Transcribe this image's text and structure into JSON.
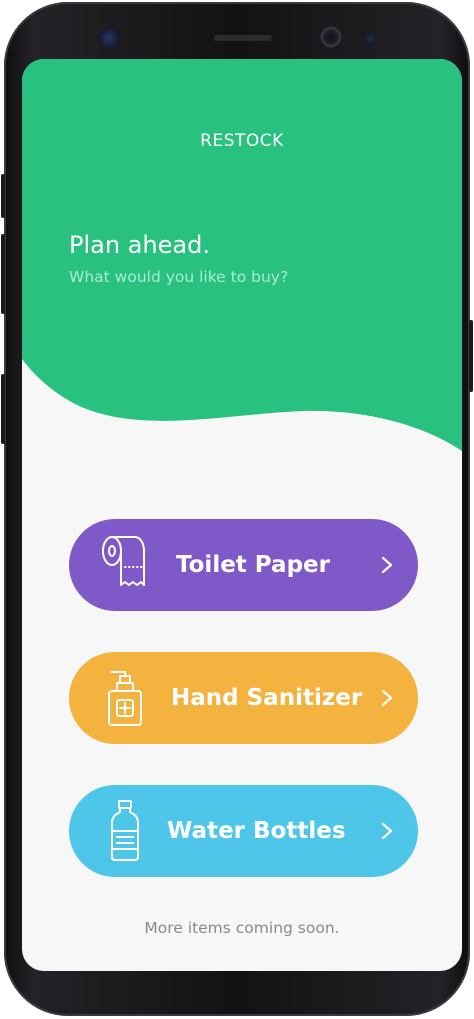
{
  "colors": {
    "header_green": "#28c17f",
    "background": "#f7f7f7",
    "toilet_paper": "#8059c8",
    "hand_sanitizer": "#f4b23e",
    "water_bottles": "#4ec6ea",
    "footer_text": "#8a8a8a"
  },
  "header": {
    "app_title": "RESTOCK",
    "headline": "Plan ahead.",
    "subheadline": "What would you like to buy?"
  },
  "categories": [
    {
      "label": "Toilet Paper",
      "icon": "toilet-paper-icon",
      "color": "#8059c8"
    },
    {
      "label": "Hand Sanitizer",
      "icon": "hand-sanitizer-icon",
      "color": "#f4b23e"
    },
    {
      "label": "Water Bottles",
      "icon": "water-bottle-icon",
      "color": "#4ec6ea"
    }
  ],
  "footer": {
    "note": "More items coming soon."
  }
}
